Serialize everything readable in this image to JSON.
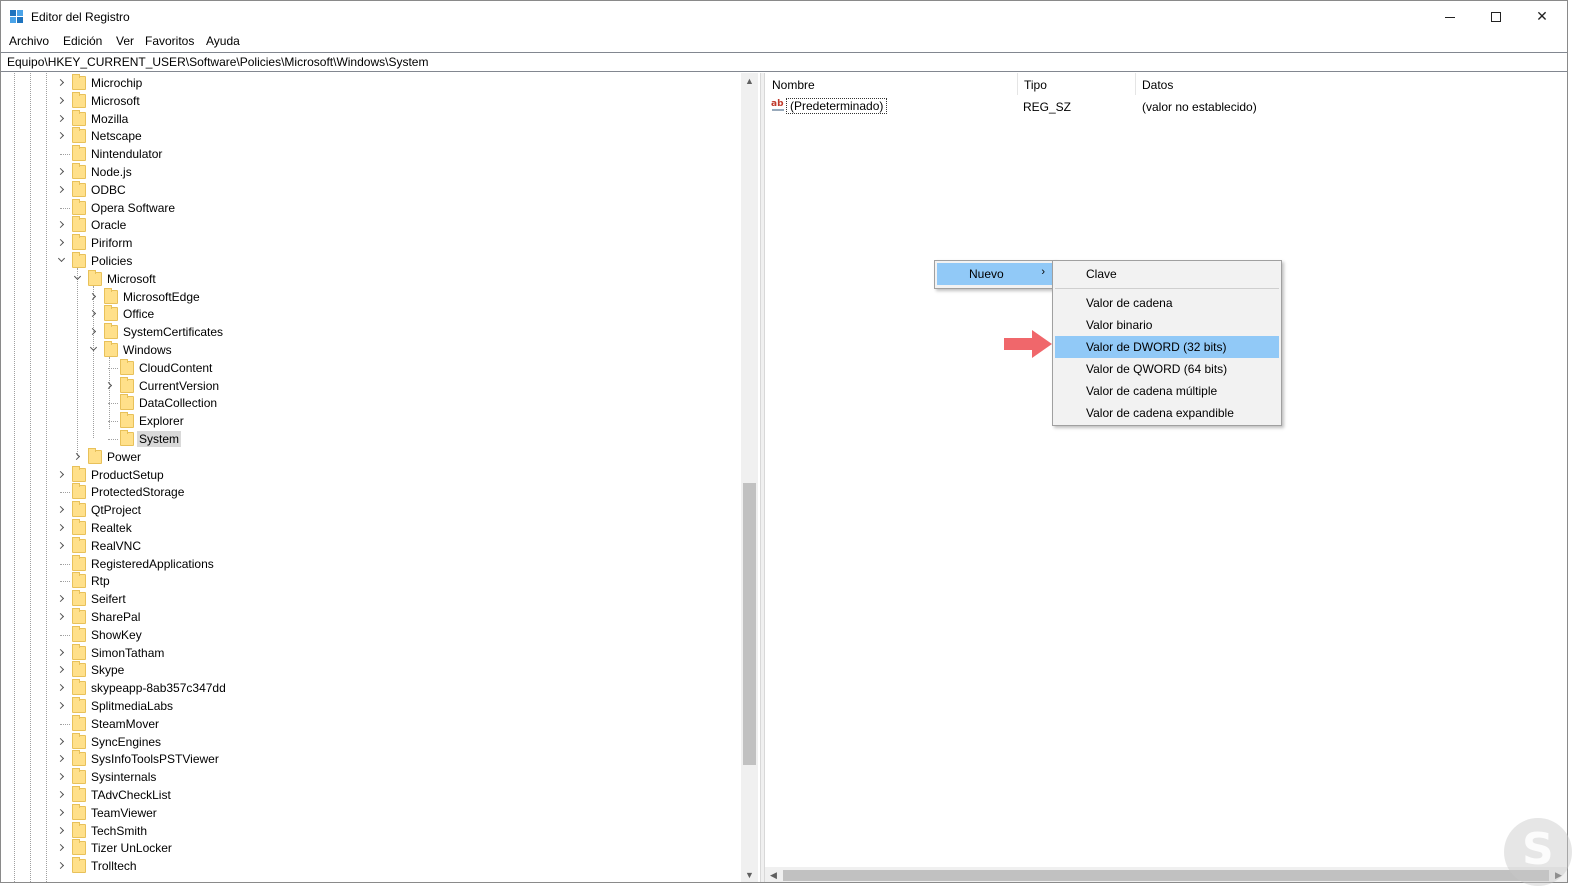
{
  "window": {
    "title": "Editor del Registro"
  },
  "menubar": [
    "Archivo",
    "Edición",
    "Ver",
    "Favoritos",
    "Ayuda"
  ],
  "address": "Equipo\\HKEY_CURRENT_USER\\Software\\Policies\\Microsoft\\Windows\\System",
  "tree": [
    {
      "label": "Microchip",
      "level": 0,
      "expander": "collapsed"
    },
    {
      "label": "Microsoft",
      "level": 0,
      "expander": "collapsed"
    },
    {
      "label": "Mozilla",
      "level": 0,
      "expander": "collapsed"
    },
    {
      "label": "Netscape",
      "level": 0,
      "expander": "collapsed"
    },
    {
      "label": "Nintendulator",
      "level": 0,
      "expander": "none"
    },
    {
      "label": "Node.js",
      "level": 0,
      "expander": "collapsed"
    },
    {
      "label": "ODBC",
      "level": 0,
      "expander": "collapsed"
    },
    {
      "label": "Opera Software",
      "level": 0,
      "expander": "none"
    },
    {
      "label": "Oracle",
      "level": 0,
      "expander": "collapsed"
    },
    {
      "label": "Piriform",
      "level": 0,
      "expander": "collapsed"
    },
    {
      "label": "Policies",
      "level": 0,
      "expander": "expanded"
    },
    {
      "label": "Microsoft",
      "level": 1,
      "expander": "expanded"
    },
    {
      "label": "MicrosoftEdge",
      "level": 2,
      "expander": "collapsed"
    },
    {
      "label": "Office",
      "level": 2,
      "expander": "collapsed"
    },
    {
      "label": "SystemCertificates",
      "level": 2,
      "expander": "collapsed"
    },
    {
      "label": "Windows",
      "level": 2,
      "expander": "expanded"
    },
    {
      "label": "CloudContent",
      "level": 3,
      "expander": "none"
    },
    {
      "label": "CurrentVersion",
      "level": 3,
      "expander": "collapsed"
    },
    {
      "label": "DataCollection",
      "level": 3,
      "expander": "none"
    },
    {
      "label": "Explorer",
      "level": 3,
      "expander": "none"
    },
    {
      "label": "System",
      "level": 3,
      "expander": "none",
      "selected": true
    },
    {
      "label": "Power",
      "level": 1,
      "expander": "collapsed"
    },
    {
      "label": "ProductSetup",
      "level": 0,
      "expander": "collapsed"
    },
    {
      "label": "ProtectedStorage",
      "level": 0,
      "expander": "none"
    },
    {
      "label": "QtProject",
      "level": 0,
      "expander": "collapsed"
    },
    {
      "label": "Realtek",
      "level": 0,
      "expander": "collapsed"
    },
    {
      "label": "RealVNC",
      "level": 0,
      "expander": "collapsed"
    },
    {
      "label": "RegisteredApplications",
      "level": 0,
      "expander": "none"
    },
    {
      "label": "Rtp",
      "level": 0,
      "expander": "none"
    },
    {
      "label": "Seifert",
      "level": 0,
      "expander": "collapsed"
    },
    {
      "label": "SharePal",
      "level": 0,
      "expander": "collapsed"
    },
    {
      "label": "ShowKey",
      "level": 0,
      "expander": "none"
    },
    {
      "label": "SimonTatham",
      "level": 0,
      "expander": "collapsed"
    },
    {
      "label": "Skype",
      "level": 0,
      "expander": "collapsed"
    },
    {
      "label": "skypeapp-8ab357c347dd",
      "level": 0,
      "expander": "collapsed"
    },
    {
      "label": "SplitmediaLabs",
      "level": 0,
      "expander": "collapsed"
    },
    {
      "label": "SteamMover",
      "level": 0,
      "expander": "none"
    },
    {
      "label": "SyncEngines",
      "level": 0,
      "expander": "collapsed"
    },
    {
      "label": "SysInfoToolsPSTViewer",
      "level": 0,
      "expander": "collapsed"
    },
    {
      "label": "Sysinternals",
      "level": 0,
      "expander": "collapsed"
    },
    {
      "label": "TAdvCheckList",
      "level": 0,
      "expander": "collapsed"
    },
    {
      "label": "TeamViewer",
      "level": 0,
      "expander": "collapsed"
    },
    {
      "label": "TechSmith",
      "level": 0,
      "expander": "collapsed"
    },
    {
      "label": "Tizer UnLocker",
      "level": 0,
      "expander": "collapsed"
    },
    {
      "label": "Trolltech",
      "level": 0,
      "expander": "collapsed"
    }
  ],
  "list": {
    "columns": [
      "Nombre",
      "Tipo",
      "Datos"
    ],
    "rows": [
      {
        "name": "(Predeterminado)",
        "type": "REG_SZ",
        "data": "(valor no establecido)"
      }
    ]
  },
  "context_menu": {
    "main_item": "Nuevo",
    "submenu": [
      {
        "label": "Clave"
      },
      {
        "separator": true
      },
      {
        "label": "Valor de cadena"
      },
      {
        "label": "Valor binario"
      },
      {
        "label": "Valor de DWORD (32 bits)",
        "highlighted": true
      },
      {
        "label": "Valor de QWORD (64 bits)"
      },
      {
        "label": "Valor de cadena múltiple"
      },
      {
        "label": "Valor de cadena expandible"
      }
    ]
  },
  "colors": {
    "highlight": "#91c9f7",
    "annotation_arrow": "#f0676b",
    "folder": "#ffe08a"
  }
}
